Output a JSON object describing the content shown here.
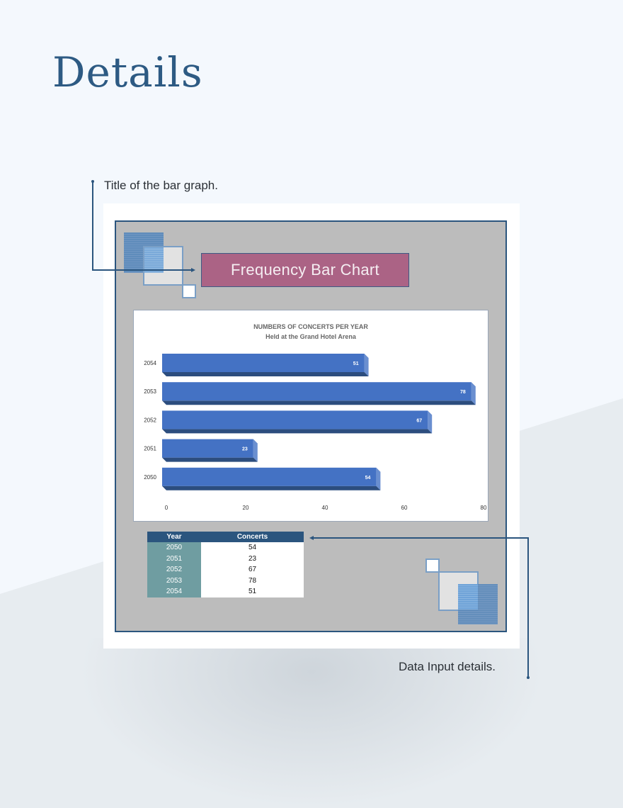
{
  "page": {
    "title": "Details",
    "annotations": {
      "title_note": "Title of the bar graph.",
      "data_note": "Data Input details."
    }
  },
  "sheet": {
    "chart_title_box": "Frequency Bar Chart",
    "colors": {
      "frame_border": "#2b557e",
      "frame_fill": "#bcbcbc",
      "title_box": "#ab6385",
      "bar": "#4472c4",
      "bar_shadow": "#2c4d7e",
      "table_header": "#2b557e",
      "table_year_col": "#6f9da1"
    },
    "table": {
      "headers": [
        "Year",
        "Concerts"
      ],
      "rows": [
        {
          "year": "2050",
          "concerts": "54"
        },
        {
          "year": "2051",
          "concerts": "23"
        },
        {
          "year": "2052",
          "concerts": "67"
        },
        {
          "year": "2053",
          "concerts": "78"
        },
        {
          "year": "2054",
          "concerts": "51"
        }
      ]
    }
  },
  "chart_data": {
    "type": "bar",
    "orientation": "horizontal",
    "title": "NUMBERS OF CONCERTS PER YEAR",
    "subtitle": "Held at the Grand Hotel Arena",
    "categories": [
      "2054",
      "2053",
      "2052",
      "2051",
      "2050"
    ],
    "values": [
      51,
      78,
      67,
      23,
      54
    ],
    "data_labels": [
      "51",
      "78",
      "67",
      "23",
      "54"
    ],
    "xlabel": "",
    "ylabel": "",
    "xlim": [
      0,
      80
    ],
    "x_ticks": [
      "0",
      "20",
      "40",
      "60",
      "80"
    ],
    "grid": false,
    "legend": "none"
  }
}
